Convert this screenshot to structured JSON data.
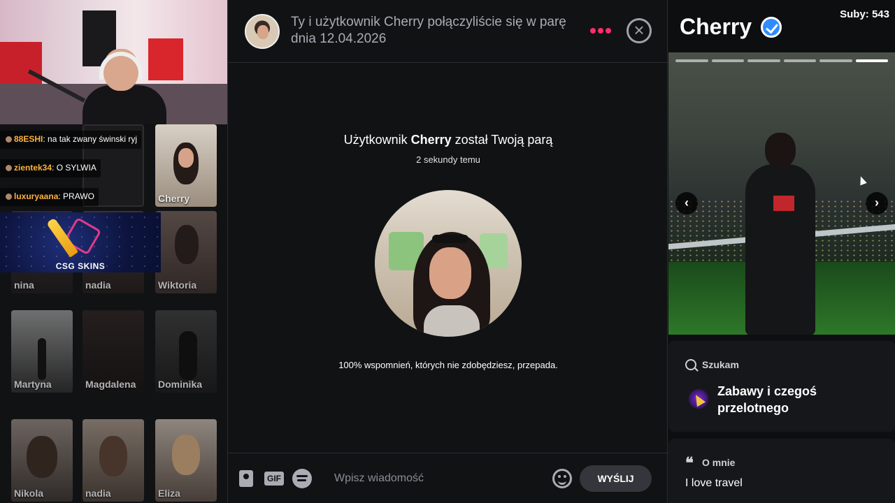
{
  "left_panel": {
    "chat_messages": [
      {
        "user": "88ESHI",
        "text": "na tak zwany świnski ryj"
      },
      {
        "user": "zientek34",
        "text": "O SYLWIA"
      },
      {
        "user": "luxuryaana",
        "text": "PRAWO"
      }
    ],
    "ad_brand": "CSG SKINS",
    "profiles": [
      {
        "name": "Cherry"
      },
      {
        "name": "nina"
      },
      {
        "name": "nadia"
      },
      {
        "name": "Wiktoria"
      },
      {
        "name": "Martyna"
      },
      {
        "name": "Magdalena"
      },
      {
        "name": "Dominika"
      },
      {
        "name": "Nikola"
      },
      {
        "name": "nadia"
      },
      {
        "name": "Eliza"
      }
    ]
  },
  "conversation": {
    "header_text": "Ty i użytkownik Cherry połączyliście się w parę dnia 12.04.2026",
    "match_prefix": "Użytkownik ",
    "match_name": "Cherry",
    "match_suffix": " został Twoją parą",
    "match_time": "2 sekundy temu",
    "quote": "100% wspomnień, których nie zdobędziesz, przepada.",
    "composer": {
      "gif_label": "GIF",
      "placeholder": "Wpisz wiadomość",
      "send_label": "WYŚLIJ"
    }
  },
  "profile_panel": {
    "name": "Cherry",
    "subs": "Suby: 543",
    "photo_count": 6,
    "active_photo_index": 5,
    "looking_for_label": "Szukam",
    "looking_for_value": "Zabawy i czegoś przelotnego",
    "about_label": "O mnie",
    "about_text": "I love travel"
  },
  "colors": {
    "accent_pink": "#ff2d6a",
    "verified_blue": "#2f8cff",
    "chat_username": "#ffb13b",
    "panel_bg": "#111214"
  }
}
